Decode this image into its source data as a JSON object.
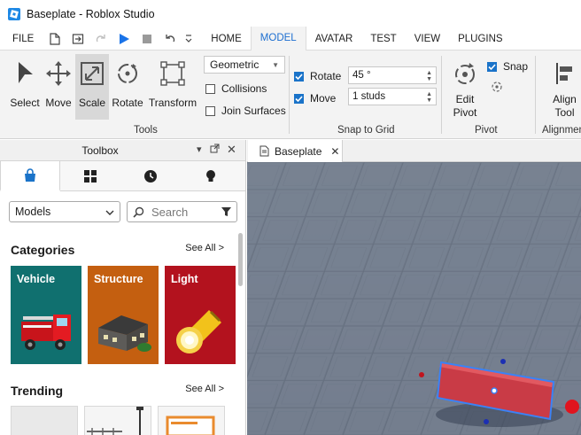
{
  "window": {
    "title": "Baseplate - Roblox Studio"
  },
  "menu": {
    "file": "FILE",
    "tabs": [
      "HOME",
      "MODEL",
      "AVATAR",
      "TEST",
      "VIEW",
      "PLUGINS"
    ],
    "active_tab": "MODEL"
  },
  "ribbon": {
    "tools": {
      "select": "Select",
      "move": "Move",
      "scale": "Scale",
      "rotate": "Rotate",
      "transform": "Transform",
      "group_label": "Tools"
    },
    "surface": {
      "dropdown_value": "Geometric",
      "collisions": "Collisions",
      "join_surfaces": "Join Surfaces"
    },
    "snap_to_grid": {
      "rotate_label": "Rotate",
      "rotate_value": "45 °",
      "move_label": "Move",
      "move_value": "1 studs",
      "group_label": "Snap to Grid"
    },
    "pivot": {
      "edit_pivot_line1": "Edit",
      "edit_pivot_line2": "Pivot",
      "snap_label": "Snap",
      "group_label": "Pivot"
    },
    "alignment": {
      "align_tool_line1": "Align",
      "align_tool_line2": "Tool",
      "group_label": "Alignmen"
    }
  },
  "toolbox": {
    "title": "Toolbox",
    "category_dropdown": "Models",
    "search_placeholder": "Search",
    "categories_title": "Categories",
    "see_all": "See All >",
    "categories": [
      {
        "label": "Vehicle",
        "color": "#10706f"
      },
      {
        "label": "Structure",
        "color": "#c45f10"
      },
      {
        "label": "Light",
        "color": "#b3121e"
      }
    ],
    "trending_title": "Trending",
    "trending_see_all": "See All >"
  },
  "viewport": {
    "tab_label": "Baseplate",
    "part_color": "#d84a52",
    "selection_color": "#3b82f6"
  },
  "colors": {
    "accent": "#1e6fd0",
    "play": "#1a73e8"
  }
}
